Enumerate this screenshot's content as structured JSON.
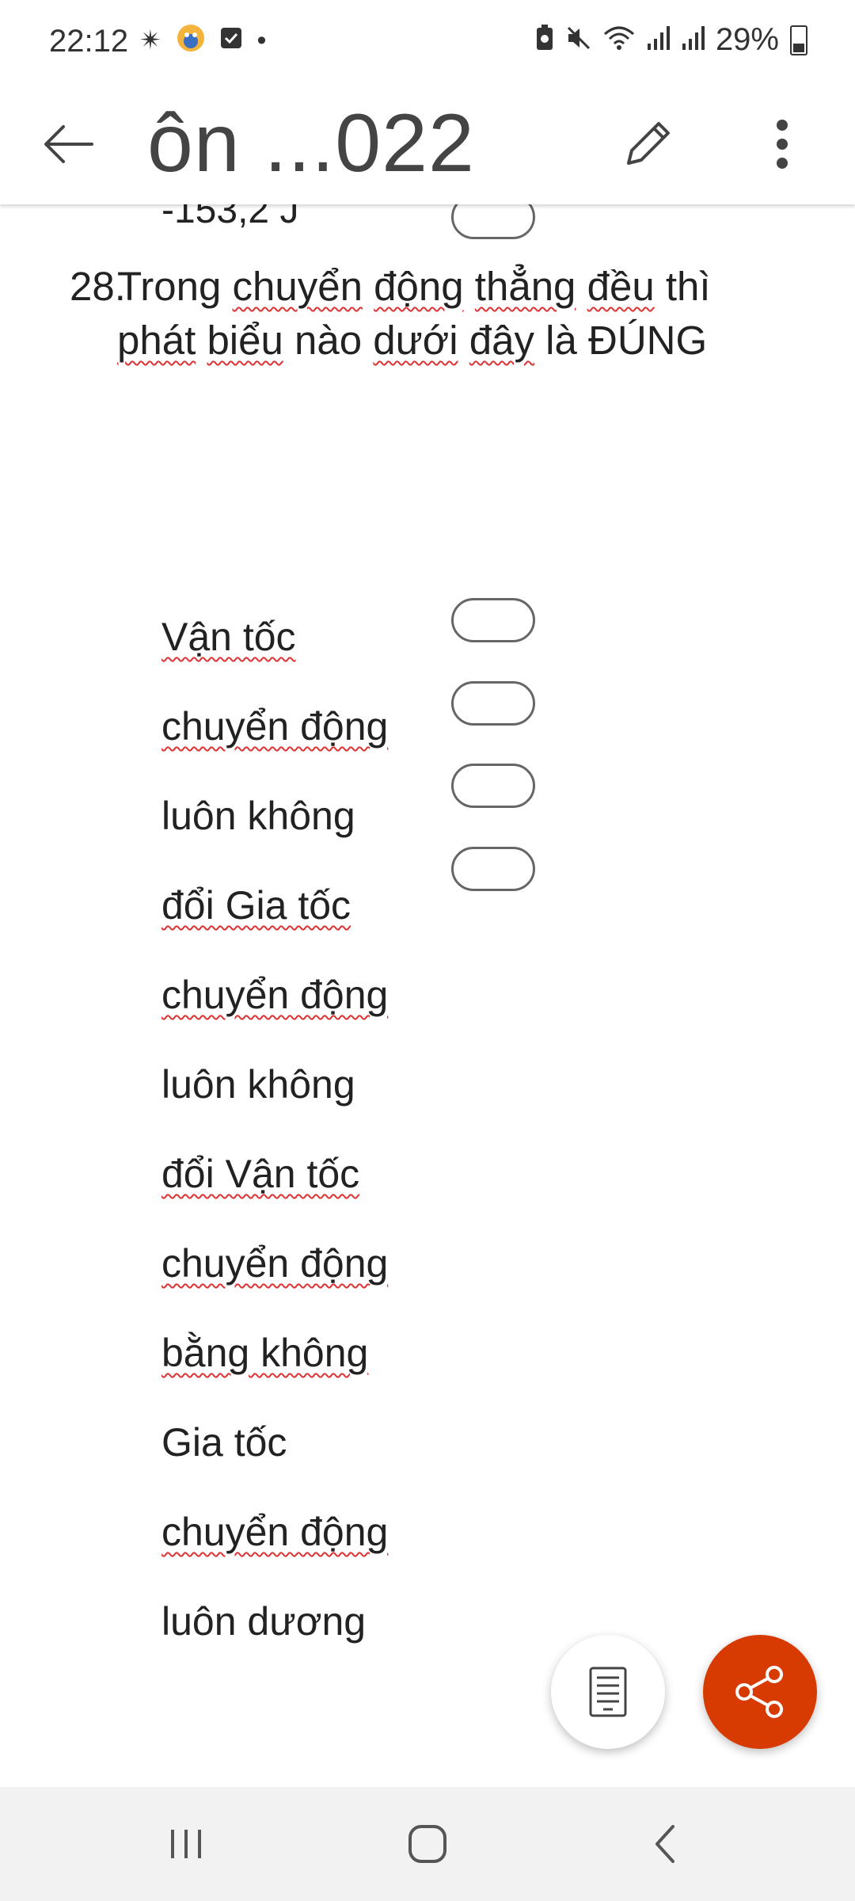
{
  "status_bar": {
    "time": "22:12",
    "battery_percent": "29%",
    "icons_left": [
      "sparkle-icon",
      "app-avatar-icon",
      "checkbox-icon",
      "dot-icon"
    ],
    "icons_right": [
      "battery-saver-icon",
      "mute-icon",
      "wifi-icon",
      "signal-icon",
      "signal-icon"
    ]
  },
  "app_bar": {
    "title": "ôn ...022",
    "back_icon": "arrow-left-icon",
    "edit_icon": "pencil-icon",
    "more_icon": "more-vertical-icon"
  },
  "document": {
    "previous_answer": "-153,2 J",
    "question_number": "28.",
    "question_text_parts": [
      "Trong ",
      "chuyển",
      " ",
      "động",
      " ",
      "thẳng",
      " ",
      "đều",
      " thì ",
      "phát",
      " ",
      "biểu",
      " nào ",
      "dưới",
      " ",
      "đây",
      " là ĐÚNG"
    ],
    "options_lines": [
      "Vận tốc",
      "chuyển động",
      "luôn không",
      "đổi Gia tốc",
      "chuyển động",
      "luôn không",
      "đổi Vận tốc",
      "chuyển động",
      "bằng không",
      "Gia tốc",
      "chuyển động",
      "luôn dương"
    ]
  },
  "fabs": {
    "reader_icon": "reading-view-icon",
    "share_icon": "share-icon",
    "share_color": "#d83b01"
  },
  "nav_bar": {
    "recents_icon": "recents-icon",
    "home_icon": "home-icon",
    "back_icon": "back-chevron-icon"
  }
}
